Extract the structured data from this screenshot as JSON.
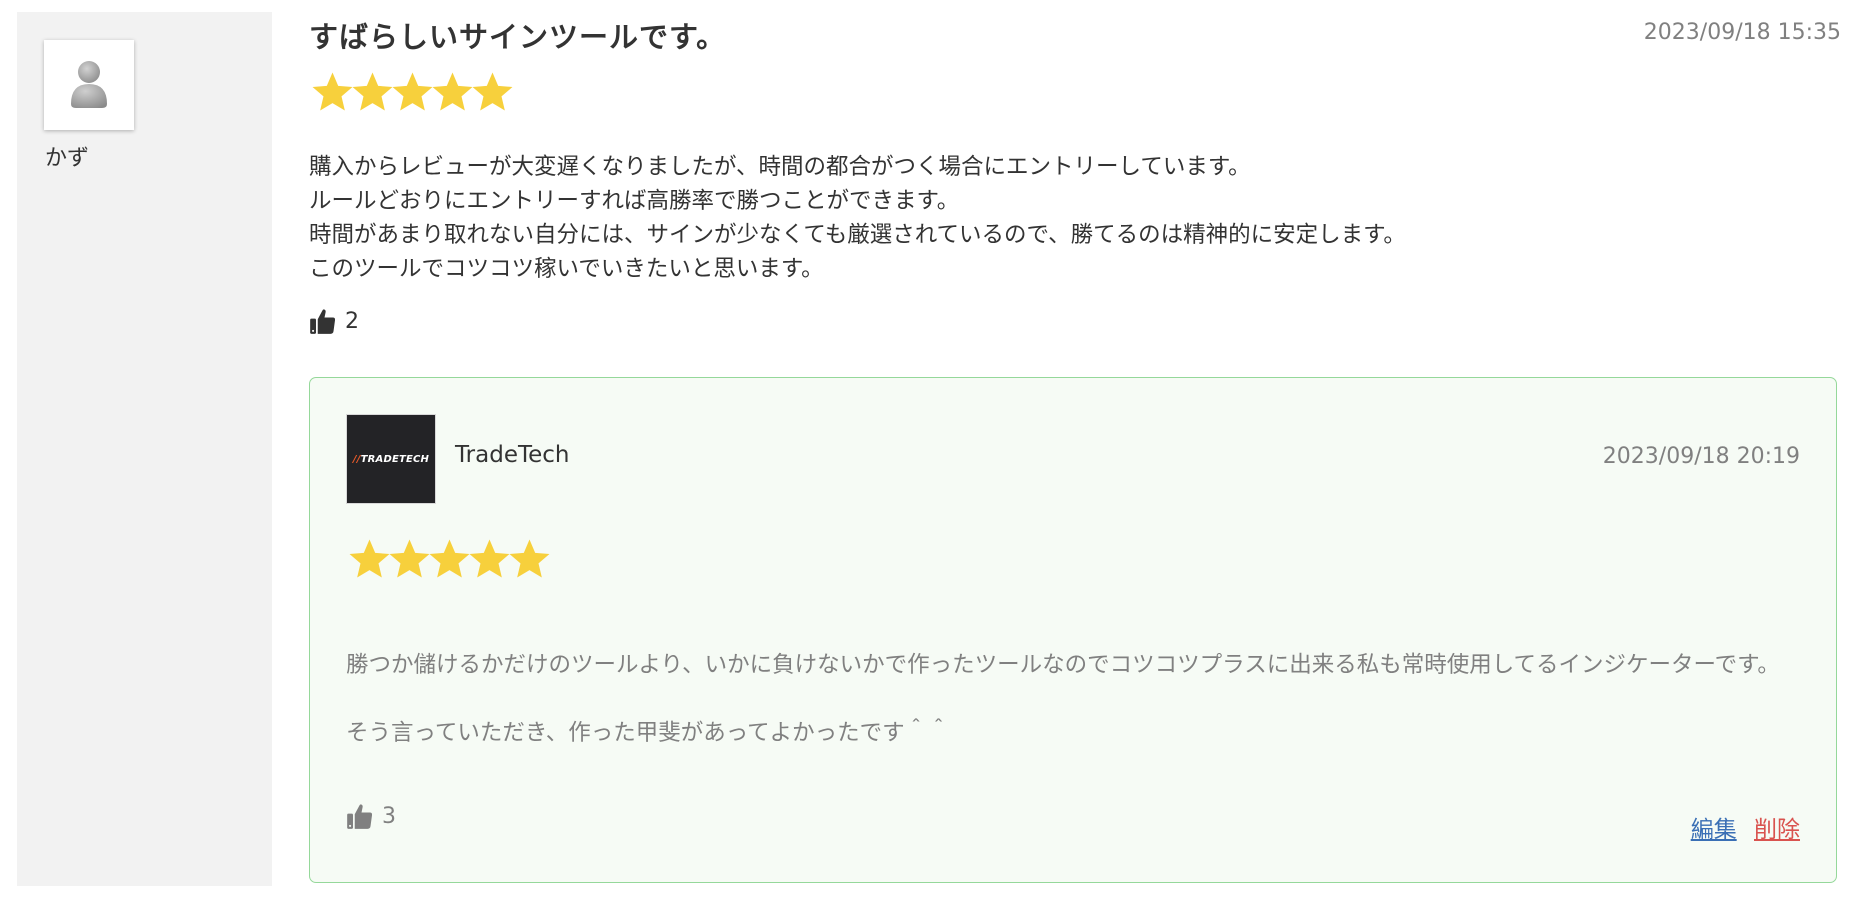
{
  "reviewer": {
    "avatar_icon": "user-silhouette-icon",
    "name": "かず"
  },
  "review": {
    "title": "すばらしいサインツールです。",
    "date": "2023/09/18 15:35",
    "rating": 5,
    "rating_max": 5,
    "star_color": "#f7d03c",
    "body_lines": [
      "購入からレビューが大変遅くなりましたが、時間の都合がつく場合にエントリーしています。",
      "ルールどおりにエントリーすれば高勝率で勝つことができます。",
      "時間があまり取れない自分には、サインが少なくても厳選されているので、勝てるのは精神的に安定します。",
      "このツールでコツコツ稼いでいきたいと思います。"
    ],
    "like_icon": "thumbs-up-icon",
    "like_count": "2"
  },
  "reply": {
    "logo_text": "//TRADETECH",
    "name": "TradeTech",
    "date": "2023/09/18 20:19",
    "rating": 5,
    "rating_max": 5,
    "body_paragraphs": [
      "勝つか儲けるかだけのツールより、いかに負けないかで作ったツールなのでコツコツプラスに出来る私も常時使用してるインジケーターです。",
      "そう言っていただき、作った甲斐があってよかったです＾＾"
    ],
    "like_icon": "thumbs-up-icon",
    "like_count": "3",
    "edit_label": "編集",
    "delete_label": "削除",
    "border_color": "#95d89a",
    "background_color": "#f6fbf5"
  }
}
